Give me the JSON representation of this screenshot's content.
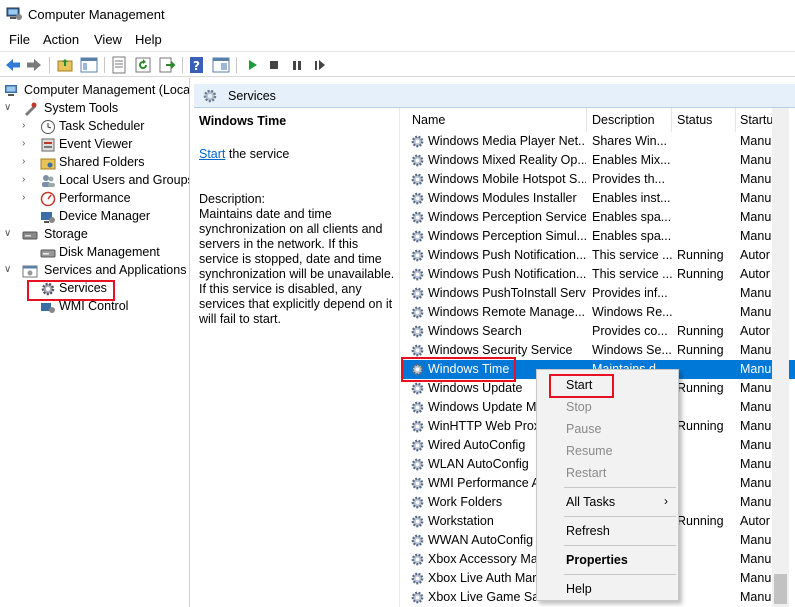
{
  "window": {
    "title": "Computer Management"
  },
  "menu": [
    "File",
    "Action",
    "View",
    "Help"
  ],
  "toolbar_icons": [
    "back-icon",
    "forward-icon",
    "up-folder-icon",
    "show-hide-tree-icon",
    "properties-icon",
    "refresh-icon",
    "export-icon",
    "help-icon",
    "view-icon",
    "play-icon",
    "stop-icon",
    "pause-icon",
    "restart-icon"
  ],
  "tree": {
    "root": "Computer Management (Local",
    "system_tools": "System Tools",
    "task_scheduler": "Task Scheduler",
    "event_viewer": "Event Viewer",
    "shared_folders": "Shared Folders",
    "local_users": "Local Users and Groups",
    "performance": "Performance",
    "device_manager": "Device Manager",
    "storage": "Storage",
    "disk_management": "Disk Management",
    "services_apps": "Services and Applications",
    "services": "Services",
    "wmi": "WMI Control"
  },
  "services_header": "Services",
  "detail": {
    "name": "Windows Time",
    "start_link": "Start",
    "start_rest": " the service",
    "desc_label": "Description:",
    "desc_text": "Maintains date and time synchronization on all clients and servers in the network. If this service is stopped, date and time synchronization will be unavailable. If this service is disabled, any services that explicitly depend on it will fail to start."
  },
  "columns": {
    "name": "Name",
    "description": "Description",
    "status": "Status",
    "startup": "Startu"
  },
  "rows": [
    {
      "name": "Windows Media Player Net...",
      "desc": "Shares Win...",
      "status": "",
      "startup": "Manu"
    },
    {
      "name": "Windows Mixed Reality Op...",
      "desc": "Enables Mix...",
      "status": "",
      "startup": "Manu"
    },
    {
      "name": "Windows Mobile Hotspot S...",
      "desc": "Provides th...",
      "status": "",
      "startup": "Manu"
    },
    {
      "name": "Windows Modules Installer",
      "desc": "Enables inst...",
      "status": "",
      "startup": "Manu"
    },
    {
      "name": "Windows Perception Service",
      "desc": "Enables spa...",
      "status": "",
      "startup": "Manu"
    },
    {
      "name": "Windows Perception Simul...",
      "desc": "Enables spa...",
      "status": "",
      "startup": "Manu"
    },
    {
      "name": "Windows Push Notification...",
      "desc": "This service ...",
      "status": "Running",
      "startup": "Autor"
    },
    {
      "name": "Windows Push Notification...",
      "desc": "This service ...",
      "status": "Running",
      "startup": "Autor"
    },
    {
      "name": "Windows PushToInstall Serv...",
      "desc": "Provides inf...",
      "status": "",
      "startup": "Manu"
    },
    {
      "name": "Windows Remote Manage...",
      "desc": "Windows Re...",
      "status": "",
      "startup": "Manu"
    },
    {
      "name": "Windows Search",
      "desc": "Provides co...",
      "status": "Running",
      "startup": "Autor"
    },
    {
      "name": "Windows Security Service",
      "desc": "Windows Se...",
      "status": "Running",
      "startup": "Manu"
    },
    {
      "name": "Windows Time",
      "desc": "Maintains d...",
      "status": "",
      "startup": "Manu"
    },
    {
      "name": "Windows Update",
      "desc": "",
      "status": "Running",
      "startup": "Manu"
    },
    {
      "name": "Windows Update M",
      "desc": "",
      "status": "",
      "startup": "Manu"
    },
    {
      "name": "WinHTTP Web Prox",
      "desc": "",
      "status": "Running",
      "startup": "Manu"
    },
    {
      "name": "Wired AutoConfig",
      "desc": "",
      "status": "",
      "startup": "Manu"
    },
    {
      "name": "WLAN AutoConfig",
      "desc": "",
      "status": "",
      "startup": "Manu"
    },
    {
      "name": "WMI Performance A",
      "desc": "",
      "status": "",
      "startup": "Manu"
    },
    {
      "name": "Work Folders",
      "desc": "",
      "status": "",
      "startup": "Manu"
    },
    {
      "name": "Workstation",
      "desc": "",
      "status": "Running",
      "startup": "Autor"
    },
    {
      "name": "WWAN AutoConfig",
      "desc": "",
      "status": "",
      "startup": "Manu"
    },
    {
      "name": "Xbox Accessory Ma",
      "desc": "",
      "status": "",
      "startup": "Manu"
    },
    {
      "name": "Xbox Live Auth Mar",
      "desc": "",
      "status": "",
      "startup": "Manu"
    },
    {
      "name": "Xbox Live Game Sav",
      "desc": "",
      "status": "",
      "startup": "Manu"
    }
  ],
  "selected_row": "Windows Time",
  "context_menu": {
    "start": "Start",
    "stop": "Stop",
    "pause": "Pause",
    "resume": "Resume",
    "restart": "Restart",
    "all_tasks": "All Tasks",
    "all_tasks_arrow": "›",
    "refresh": "Refresh",
    "properties": "Properties",
    "help": "Help"
  },
  "colors": {
    "selection": "#0078d7",
    "highlight": "#e81123",
    "header_bg": "#e6f0fb",
    "link": "#0066cc"
  }
}
